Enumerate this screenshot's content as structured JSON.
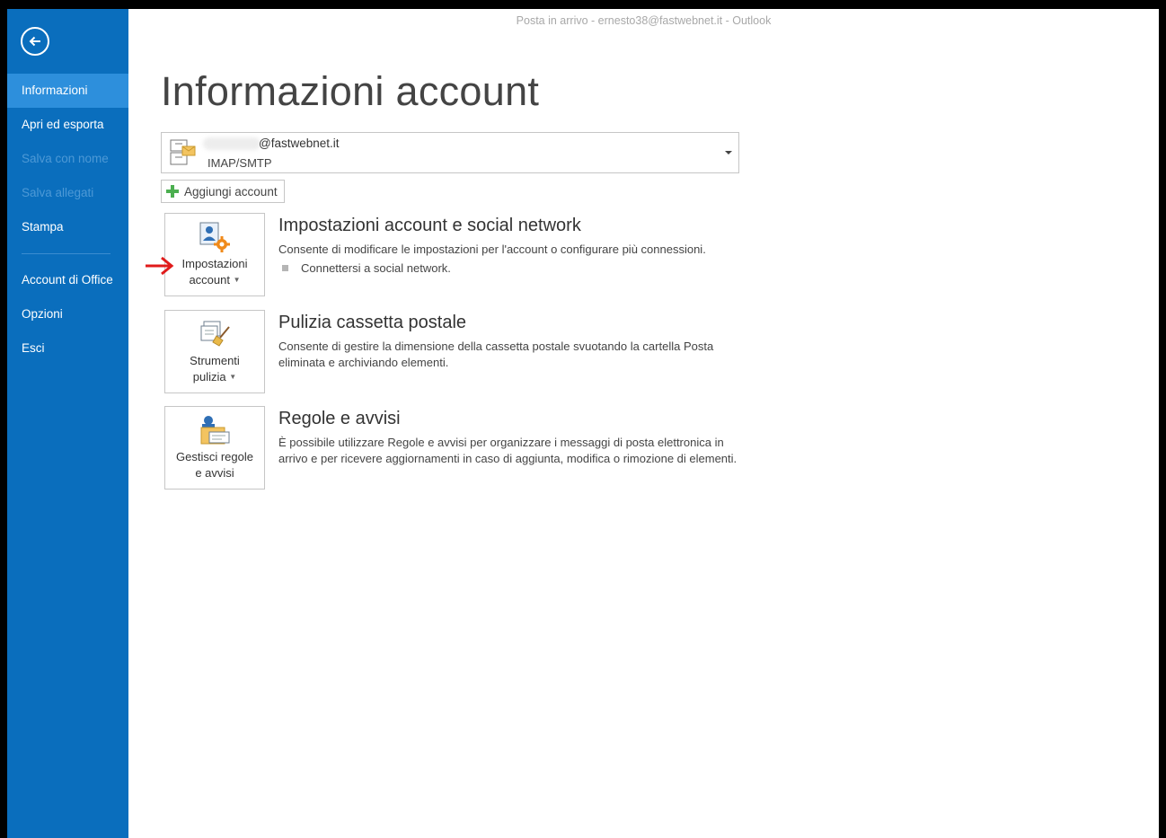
{
  "window": {
    "title": "Posta in arrivo - ernesto38@fastwebnet.it - Outlook"
  },
  "sidebar": {
    "items": [
      {
        "label": "Informazioni",
        "state": "active"
      },
      {
        "label": "Apri ed esporta",
        "state": "normal"
      },
      {
        "label": "Salva con nome",
        "state": "disabled"
      },
      {
        "label": "Salva allegati",
        "state": "disabled"
      },
      {
        "label": "Stampa",
        "state": "normal"
      },
      {
        "label": "Account di Office",
        "state": "normal"
      },
      {
        "label": "Opzioni",
        "state": "normal"
      },
      {
        "label": "Esci",
        "state": "normal"
      }
    ]
  },
  "page": {
    "title": "Informazioni account"
  },
  "account": {
    "email": "@fastwebnet.it",
    "protocol": "IMAP/SMTP"
  },
  "add_account": {
    "label": "Aggiungi account"
  },
  "sections": [
    {
      "tile_label_1": "Impostazioni",
      "tile_label_2": "account",
      "heading": "Impostazioni account e social network",
      "description": "Consente di modificare le impostazioni per l'account o configurare più connessioni.",
      "bullet": "Connettersi a social network."
    },
    {
      "tile_label_1": "Strumenti",
      "tile_label_2": "pulizia",
      "heading": "Pulizia cassetta postale",
      "description": "Consente di gestire la dimensione della cassetta postale svuotando la cartella Posta eliminata e archiviando elementi."
    },
    {
      "tile_label_1": "Gestisci regole",
      "tile_label_2": "e avvisi",
      "heading": "Regole e avvisi",
      "description": "È possibile utilizzare Regole e avvisi per organizzare i messaggi di posta elettronica in arrivo e per ricevere aggiornamenti in caso di aggiunta, modifica o rimozione di elementi."
    }
  ],
  "colors": {
    "sidebar": "#0a6ebd",
    "sidebar_active": "#2d8fdc",
    "annotation_arrow": "#e01b1b",
    "add_icon": "#4caf50"
  }
}
